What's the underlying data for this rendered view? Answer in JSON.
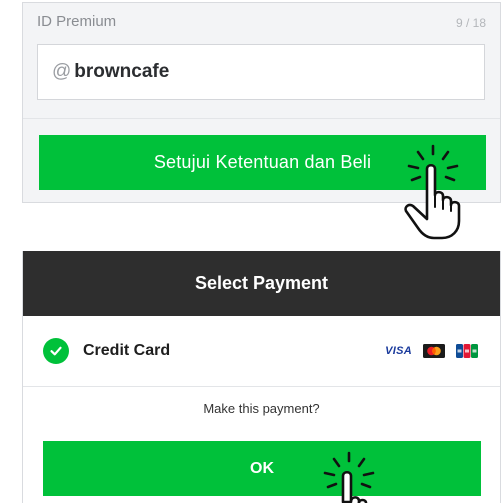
{
  "premium_id": {
    "label": "ID Premium",
    "counter": "9 / 18",
    "prefix": "@",
    "value": "browncafe"
  },
  "purchase": {
    "button_label": "Setujui Ketentuan dan Beli"
  },
  "payment": {
    "title": "Select Payment",
    "method_label": "Credit Card",
    "method_selected": true,
    "card_brands": [
      "visa-logo",
      "mastercard-logo",
      "jcb-logo"
    ],
    "visa_text": "VISA",
    "confirm_text": "Make this payment?",
    "ok_label": "OK"
  },
  "colors": {
    "accent_green": "#00c13a",
    "header_dark": "#2e2e2e"
  },
  "icons": [
    "tap-hand-cursor-icon",
    "checkmark-icon"
  ]
}
